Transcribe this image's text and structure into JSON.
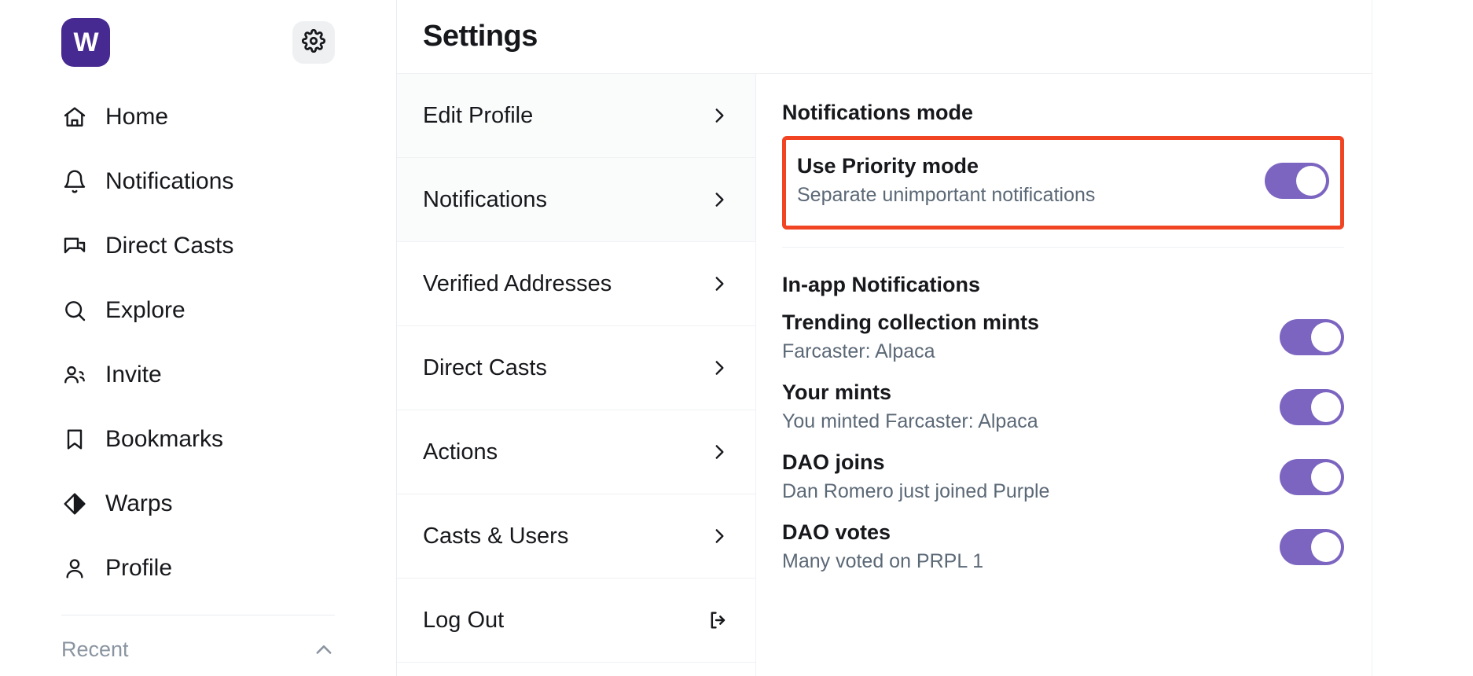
{
  "sidebar": {
    "logo_text": "W",
    "logo_color": "#472a91",
    "gear_icon": "gear-icon",
    "items": [
      {
        "label": "Home",
        "icon": "home-icon"
      },
      {
        "label": "Notifications",
        "icon": "bell-icon"
      },
      {
        "label": "Direct Casts",
        "icon": "chat-bubbles-icon"
      },
      {
        "label": "Explore",
        "icon": "search-icon"
      },
      {
        "label": "Invite",
        "icon": "people-icon"
      },
      {
        "label": "Bookmarks",
        "icon": "bookmark-icon"
      },
      {
        "label": "Warps",
        "icon": "diamond-icon"
      },
      {
        "label": "Profile",
        "icon": "person-icon"
      }
    ],
    "recent": {
      "label": "Recent",
      "icon": "chevron-up-icon"
    }
  },
  "settings": {
    "title": "Settings",
    "menu": [
      {
        "label": "Edit Profile",
        "icon": "chevron-right-icon",
        "shaded": true
      },
      {
        "label": "Notifications",
        "icon": "chevron-right-icon",
        "shaded": true
      },
      {
        "label": "Verified Addresses",
        "icon": "chevron-right-icon",
        "shaded": false
      },
      {
        "label": "Direct Casts",
        "icon": "chevron-right-icon",
        "shaded": false
      },
      {
        "label": "Actions",
        "icon": "chevron-right-icon",
        "shaded": false
      },
      {
        "label": "Casts & Users",
        "icon": "chevron-right-icon",
        "shaded": false
      },
      {
        "label": "Log Out",
        "icon": "sign-out-icon",
        "shaded": false
      }
    ]
  },
  "content": {
    "notifications_mode_heading": "Notifications mode",
    "highlight_color": "#f04423",
    "toggle_on_color": "#7c65c1",
    "priority": {
      "title": "Use Priority mode",
      "subtitle": "Separate unimportant notifications",
      "toggle_state": "on"
    },
    "in_app_heading": "In-app Notifications",
    "in_app_items": [
      {
        "title": "Trending collection mints",
        "subtitle": "Farcaster: Alpaca",
        "toggle_state": "on"
      },
      {
        "title": "Your mints",
        "subtitle": "You minted Farcaster: Alpaca",
        "toggle_state": "on"
      },
      {
        "title": "DAO joins",
        "subtitle": "Dan Romero just joined Purple",
        "toggle_state": "on"
      },
      {
        "title": "DAO votes",
        "subtitle": "Many voted on PRPL 1",
        "toggle_state": "on"
      }
    ]
  }
}
